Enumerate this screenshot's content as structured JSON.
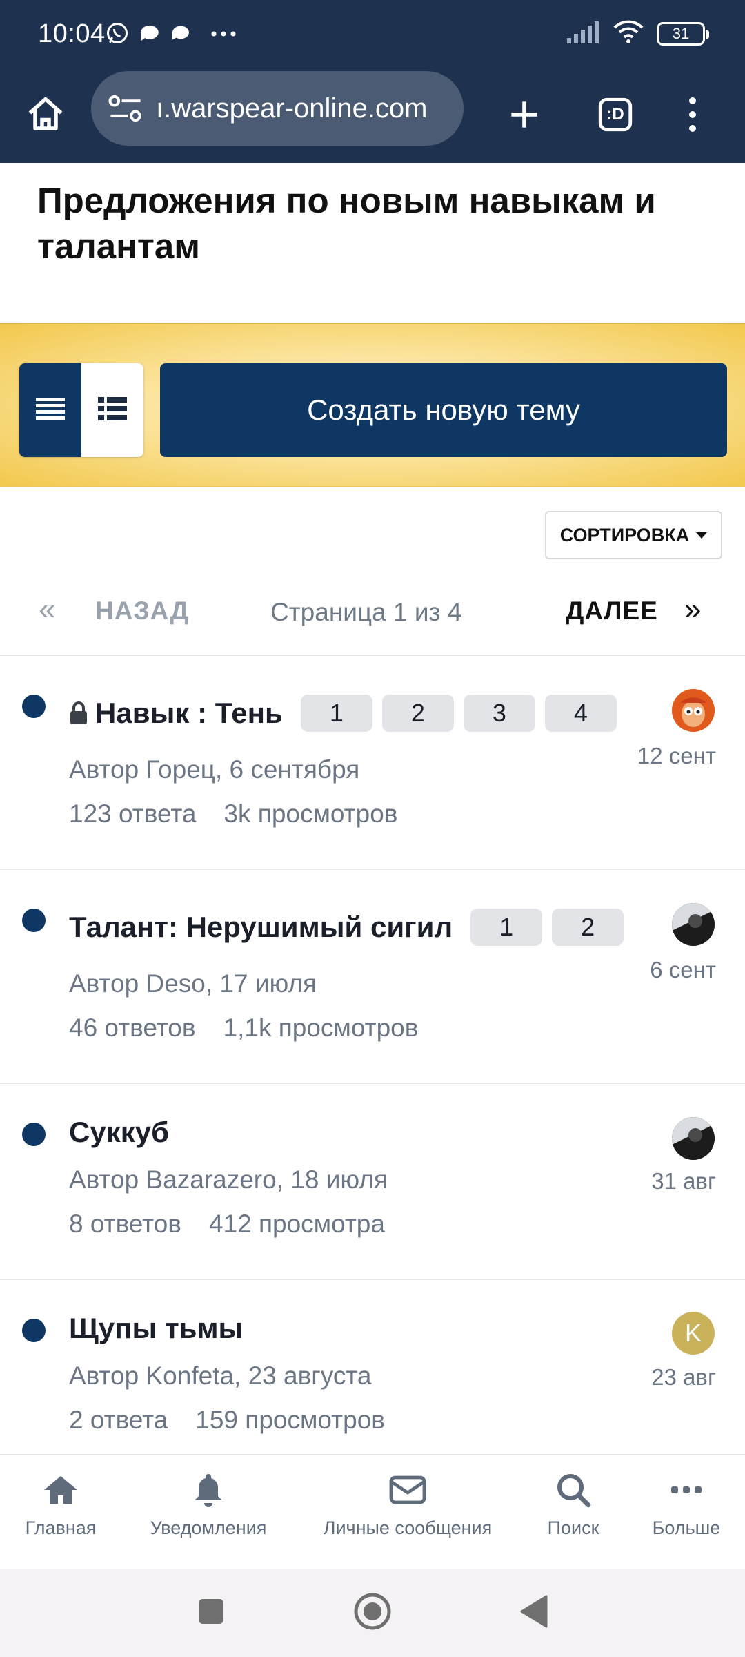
{
  "status_bar": {
    "time": "10:04",
    "notification_icons": [
      "whatsapp-icon",
      "chat-bubble-icon",
      "message-icon",
      "more-dots-icon"
    ],
    "battery": "31"
  },
  "browser": {
    "url": "ı.warspear-online.com",
    "tab_count_label": ":D"
  },
  "page": {
    "title": "Предложения по новым навыкам и талантам"
  },
  "banner": {
    "create_topic_label": "Создать новую тему"
  },
  "controls": {
    "sort_label": "СОРТИРОВКА",
    "prev_label": "НАЗАД",
    "next_label": "ДАЛЕЕ",
    "page_status": "Страница 1 из 4",
    "prev_arrow": "«",
    "next_arrow": "»"
  },
  "topics": [
    {
      "locked": true,
      "title": "Навык : Тень",
      "pages": [
        "1",
        "2",
        "3",
        "4"
      ],
      "meta": "Автор Горец, 6 сентября",
      "replies": "123 ответа",
      "views": "3k просмотров",
      "last_date": "12 сент",
      "avatar": "cartoon-face-avatar"
    },
    {
      "locked": false,
      "title": "Талант: Нерушимый сигил",
      "pages": [
        "1",
        "2"
      ],
      "meta": "Автор Deso, 17 июля",
      "replies": "46 ответов",
      "views": "1,1k просмотров",
      "last_date": "6 сент",
      "avatar": "photo-avatar"
    },
    {
      "locked": false,
      "title": "Суккуб",
      "pages": [],
      "meta": "Автор Bazarazero, 18 июля",
      "replies": "8 ответов",
      "views": "412 просмотра",
      "last_date": "31 авг",
      "avatar": "photo-avatar"
    },
    {
      "locked": false,
      "title": "Щупы тьмы",
      "pages": [],
      "meta": "Автор Konfeta, 23 августа",
      "replies": "2 ответа",
      "views": "159 просмотров",
      "last_date": "23 авг",
      "avatar_letter": "K"
    }
  ],
  "bottom_nav": [
    {
      "label": "Главная",
      "icon": "home-icon"
    },
    {
      "label": "Уведомления",
      "icon": "bell-icon"
    },
    {
      "label": "Личные сообщения",
      "icon": "envelope-icon"
    },
    {
      "label": "Поиск",
      "icon": "search-icon"
    },
    {
      "label": "Больше",
      "icon": "more-icon"
    }
  ],
  "colors": {
    "chrome": "#1e3250",
    "brand_navy": "#0e3764",
    "banner_gold": "#f2c84d",
    "muted_text": "#6b7584"
  }
}
